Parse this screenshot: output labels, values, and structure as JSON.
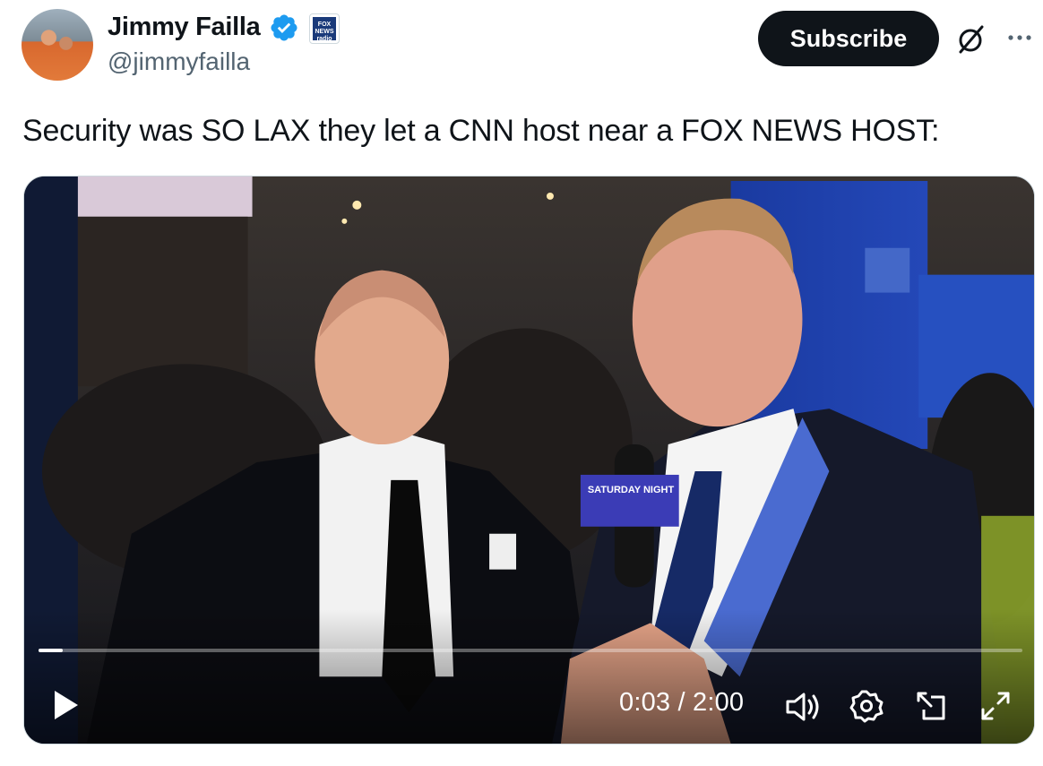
{
  "author": {
    "name": "Jimmy Failla",
    "handle": "@jimmyfailla",
    "verified_icon": "verified-badge-icon",
    "affiliate_badge_text": "FOX NEWS radio"
  },
  "actions": {
    "subscribe_label": "Subscribe",
    "grok_icon": "grok-icon",
    "more_icon": "more-icon"
  },
  "tweet": {
    "text": "Security was SO LAX they let a CNN host near a FOX NEWS HOST:"
  },
  "video": {
    "current_time": "0:03",
    "duration": "2:00",
    "time_display": "0:03 / 2:00",
    "progress_fraction": 0.025,
    "mic_flag_text": "SATURDAY NIGHT"
  },
  "colors": {
    "accent_black": "#0f1419",
    "secondary_text": "#536471",
    "verified_blue": "#1d9bf0"
  }
}
